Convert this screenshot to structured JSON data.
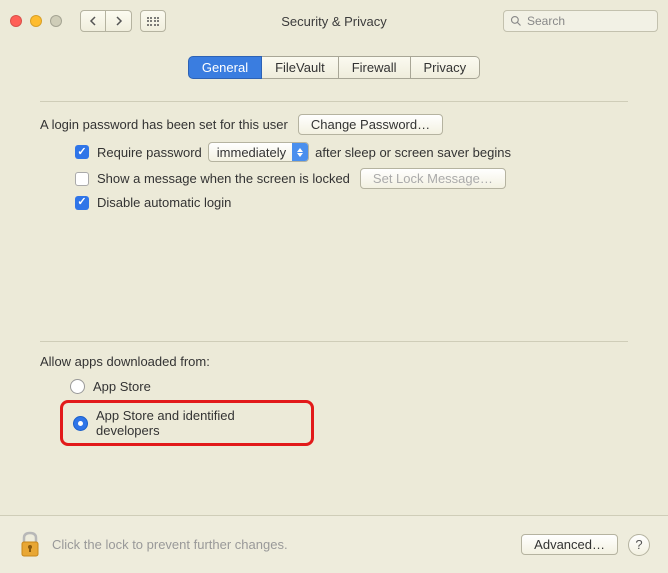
{
  "window": {
    "title": "Security & Privacy"
  },
  "search": {
    "placeholder": "Search"
  },
  "tabs": [
    {
      "label": "General",
      "active": true
    },
    {
      "label": "FileVault",
      "active": false
    },
    {
      "label": "Firewall",
      "active": false
    },
    {
      "label": "Privacy",
      "active": false
    }
  ],
  "password_section": {
    "set_text": "A login password has been set for this user",
    "change_btn": "Change Password…",
    "require_label": "Require password",
    "require_timing": "immediately",
    "require_after": "after sleep or screen saver begins",
    "show_message_label": "Show a message when the screen is locked",
    "set_lock_btn": "Set Lock Message…",
    "disable_auto_label": "Disable automatic login"
  },
  "download_section": {
    "heading": "Allow apps downloaded from:",
    "option1": "App Store",
    "option2": "App Store and identified developers"
  },
  "footer": {
    "lock_text": "Click the lock to prevent further changes.",
    "advanced_btn": "Advanced…"
  }
}
